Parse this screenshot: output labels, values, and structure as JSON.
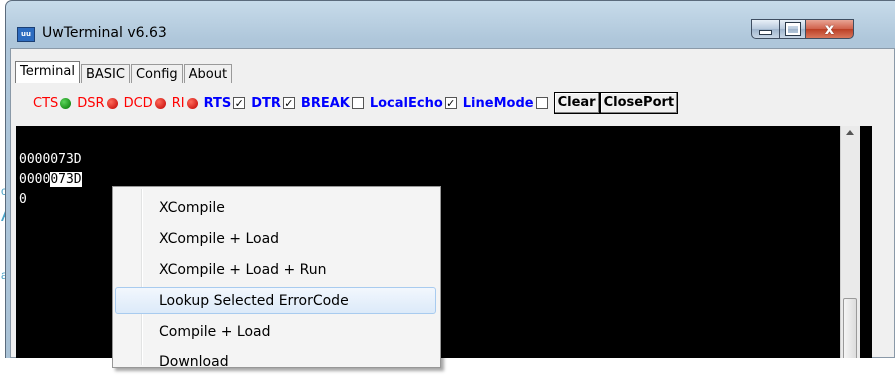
{
  "background": {
    "letters": [
      "c",
      "A",
      "a"
    ]
  },
  "window": {
    "title": "UwTerminal v6.63",
    "icon_text": "uu",
    "buttons": {
      "minimize": "minimize-icon",
      "maximize": "maximize-icon",
      "close": "close-icon"
    },
    "close_glyph": "x"
  },
  "tabs": [
    {
      "label": "Terminal",
      "active": true
    },
    {
      "label": "BASIC",
      "active": false
    },
    {
      "label": "Config",
      "active": false
    },
    {
      "label": "About",
      "active": false
    }
  ],
  "signals": [
    {
      "label": "CTS",
      "state": "green"
    },
    {
      "label": "DSR",
      "state": "red"
    },
    {
      "label": "DCD",
      "state": "red"
    },
    {
      "label": "RI",
      "state": "red"
    }
  ],
  "checks": [
    {
      "label": "RTS",
      "checked": true,
      "mark": "✓"
    },
    {
      "label": "DTR",
      "checked": true,
      "mark": "✓"
    },
    {
      "label": "BREAK",
      "checked": false,
      "mark": ""
    },
    {
      "label": "LocalEcho",
      "checked": true,
      "mark": "✓"
    },
    {
      "label": "LineMode",
      "checked": false,
      "mark": ""
    }
  ],
  "buttons": {
    "clear": "Clear",
    "closeport": "ClosePort"
  },
  "terminal": {
    "lines": [
      {
        "text": "0000073D"
      },
      {
        "pre": "0000",
        "selected": "073D"
      },
      {
        "text": "0"
      }
    ]
  },
  "context_menu": {
    "items": [
      {
        "label": "XCompile",
        "highlighted": false
      },
      {
        "label": "XCompile + Load",
        "highlighted": false
      },
      {
        "label": "XCompile + Load + Run",
        "highlighted": false
      },
      {
        "label": "Lookup Selected ErrorCode",
        "highlighted": true
      },
      {
        "label": "Compile + Load",
        "highlighted": false
      },
      {
        "label": "Download",
        "highlighted": false
      }
    ]
  }
}
